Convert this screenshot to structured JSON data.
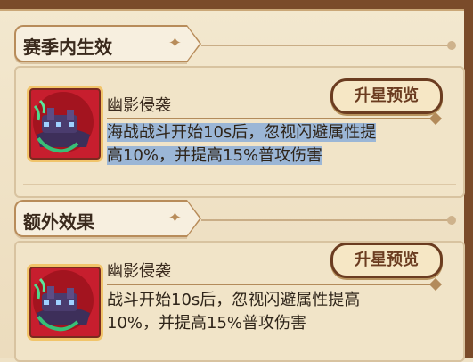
{
  "sections": [
    {
      "title": "赛季内生效",
      "ability": {
        "name": "幽影侵袭",
        "description_line1": "海战战斗开始10s后，忽视闪避属性提",
        "description_line2": "高10%，并提高15%普攻伤害",
        "selected": true,
        "icon": "ghost-ship-icon"
      },
      "preview_button": "升星预览"
    },
    {
      "title": "额外效果",
      "ability": {
        "name": "幽影侵袭",
        "description_line1": "战斗开始10s后，忽视闪避属性提高",
        "description_line2": "10%，并提高15%普攻伤害",
        "selected": false,
        "icon": "ghost-ship-icon"
      },
      "preview_button": "升星预览"
    }
  ],
  "colors": {
    "selection": "#9bb6d6",
    "accent_brown": "#6b3c20",
    "icon_red": "#c71e2e"
  }
}
